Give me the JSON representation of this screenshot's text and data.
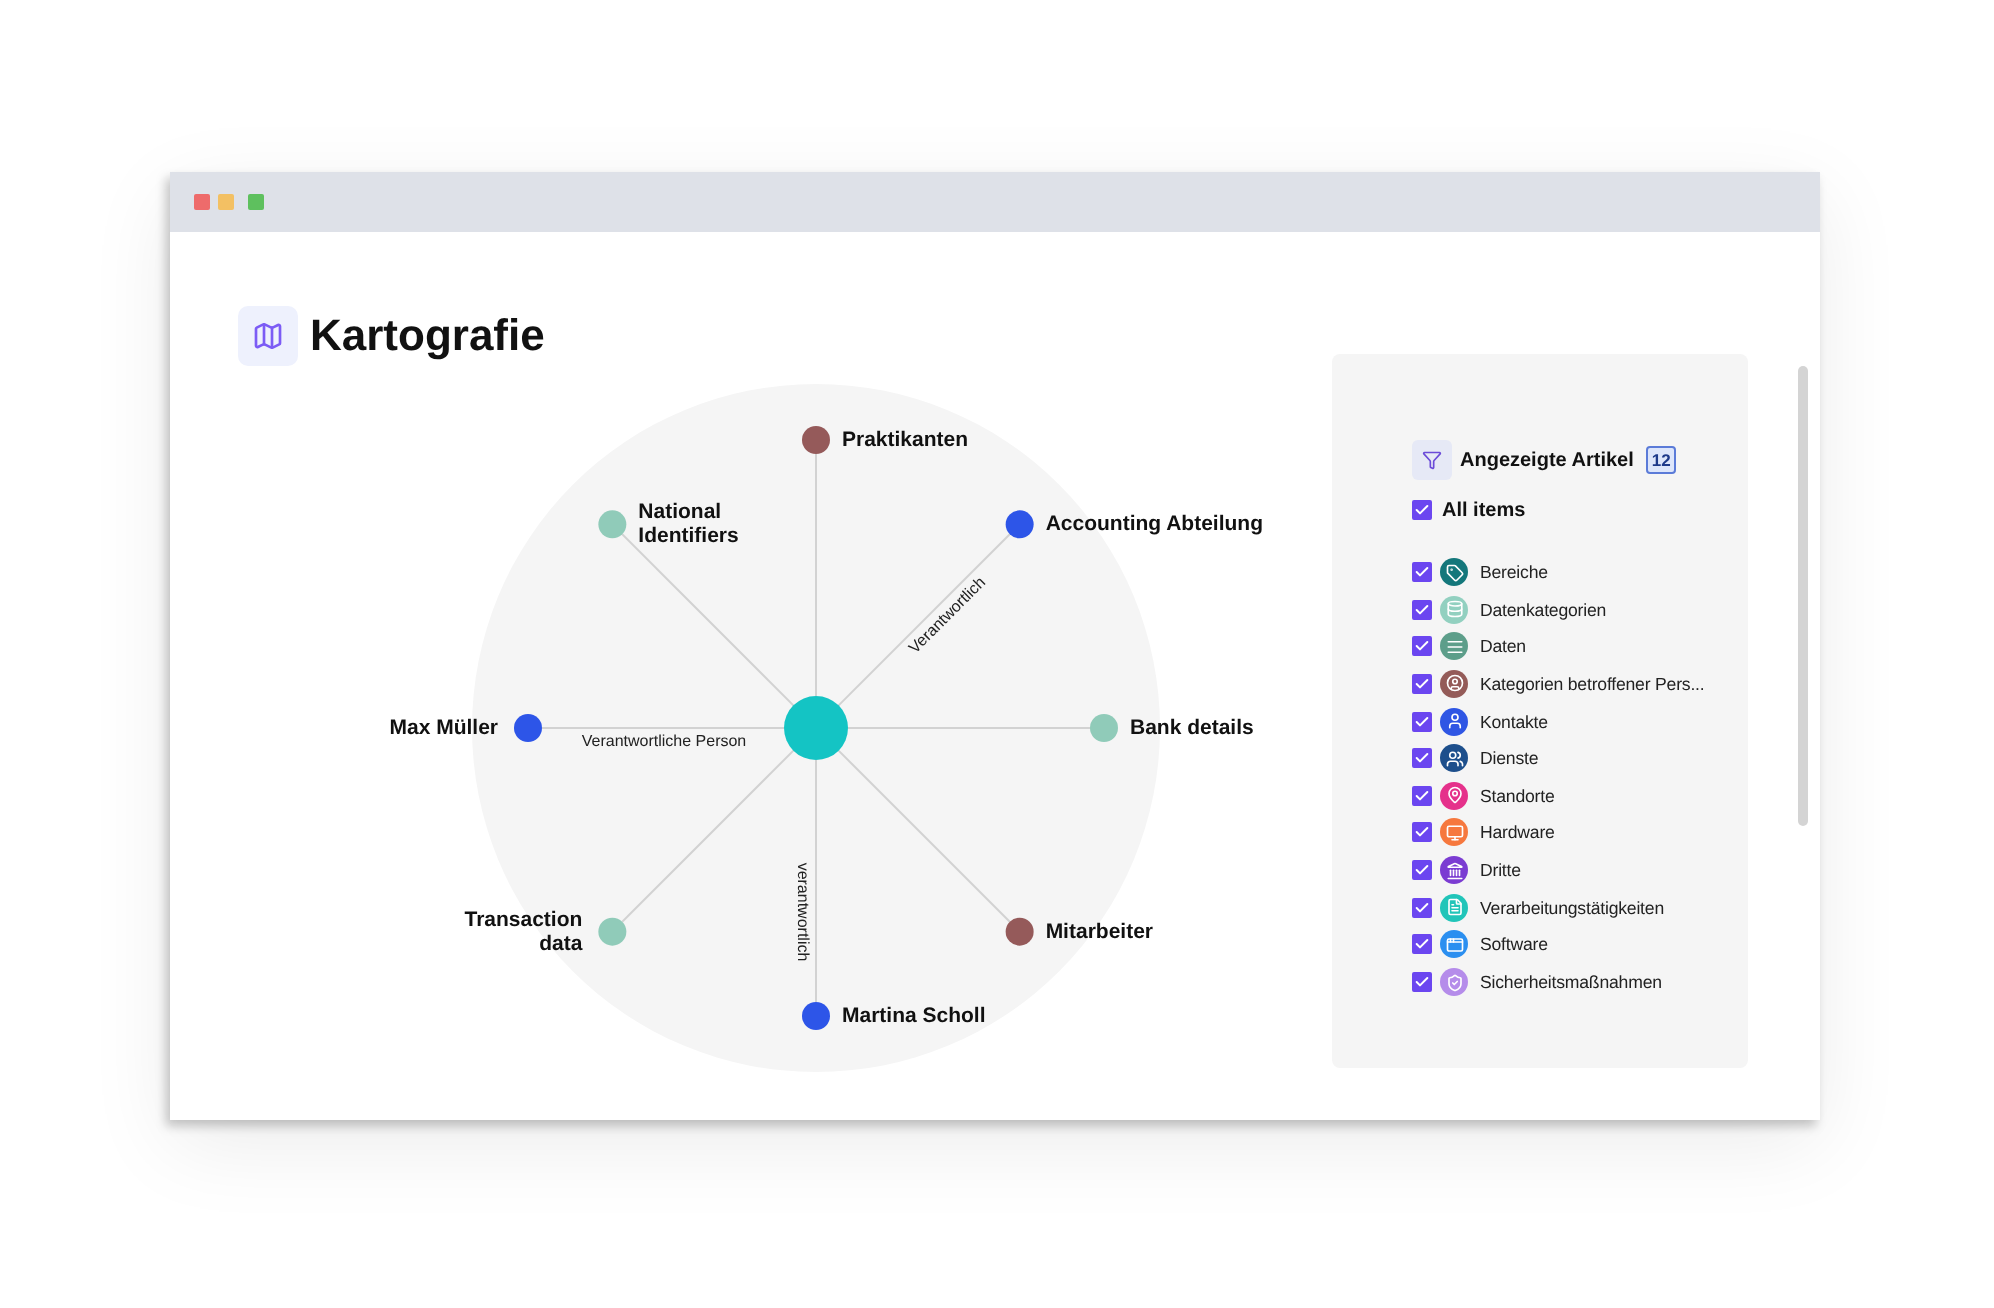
{
  "page": {
    "title": "Kartografie"
  },
  "graph": {
    "nodes": [
      {
        "label": "Praktikanten",
        "color": "#955a5a"
      },
      {
        "label": "National Identifiers",
        "color": "#90cbb9"
      },
      {
        "label": "Accounting Abteilung",
        "color": "#2d55e8",
        "edge_label": "Verantwortlich"
      },
      {
        "label": "Max Müller",
        "color": "#2d55e8",
        "edge_label": "Verantwortliche Person"
      },
      {
        "label": "Bank details",
        "color": "#90cbb9"
      },
      {
        "label": "Transaction data",
        "color": "#90cbb9"
      },
      {
        "label": "Mitarbeiter",
        "color": "#955a5a"
      },
      {
        "label": "Martina Scholl",
        "color": "#2d55e8",
        "edge_label": "verantwortlich"
      }
    ]
  },
  "filter_panel": {
    "title": "Angezeigte Artikel",
    "count": "12",
    "all_items": {
      "label": "All items",
      "checked": true
    },
    "items": [
      {
        "label": "Bereiche",
        "color": "#14777b",
        "checked": true
      },
      {
        "label": "Datenkategorien",
        "color": "#92d0c0",
        "checked": true
      },
      {
        "label": "Daten",
        "color": "#5d9e8a",
        "checked": true
      },
      {
        "label": "Kategorien betroffener Pers...",
        "color": "#945b58",
        "checked": true
      },
      {
        "label": "Kontakte",
        "color": "#2f56e4",
        "checked": true
      },
      {
        "label": "Dienste",
        "color": "#1d4f8c",
        "checked": true
      },
      {
        "label": "Standorte",
        "color": "#e5318b",
        "checked": true
      },
      {
        "label": "Hardware",
        "color": "#f6783e",
        "checked": true
      },
      {
        "label": "Dritte",
        "color": "#7b3cd2",
        "checked": true
      },
      {
        "label": "Verarbeitungstätigkeiten",
        "color": "#21c5b9",
        "checked": true
      },
      {
        "label": "Software",
        "color": "#2b8ff0",
        "checked": true
      },
      {
        "label": "Sicherheitsmaßnahmen",
        "color": "#b58cea",
        "checked": true
      }
    ]
  }
}
